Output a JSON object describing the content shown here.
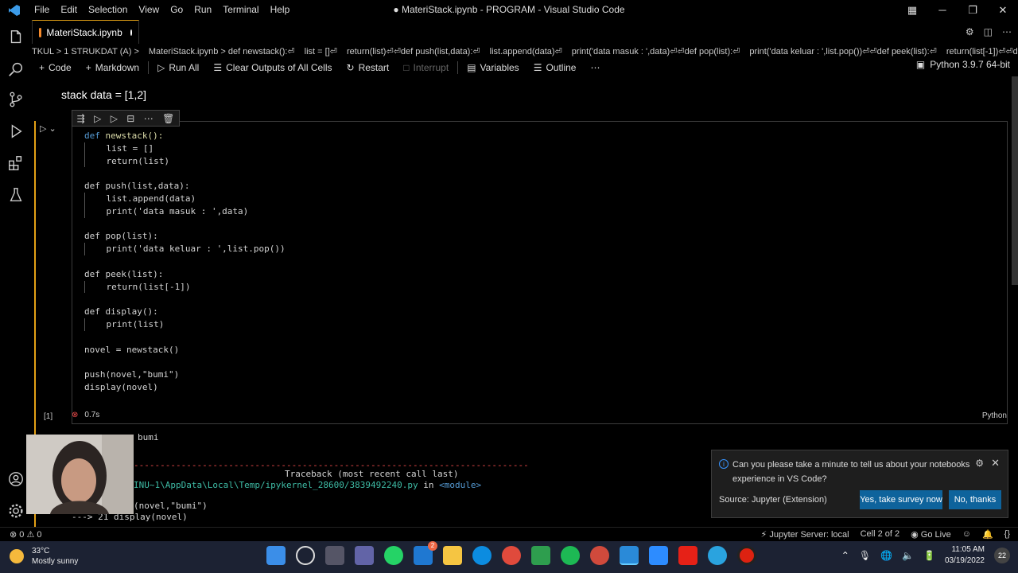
{
  "titlebar": {
    "menu": [
      "File",
      "Edit",
      "Selection",
      "View",
      "Go",
      "Run",
      "Terminal",
      "Help"
    ],
    "title": "● MateriStack.ipynb - PROGRAM - Visual Studio Code"
  },
  "tab": {
    "label": "MateriStack.ipynb"
  },
  "breadcrumbs": [
    "TKUL > 1 STRUKDAT (A) >",
    "MateriStack.ipynb > def newstack():⏎",
    "list = []⏎",
    "return(list)⏎⏎def push(list,data):⏎",
    "list.append(data)⏎",
    "print('data masuk : ',data)⏎⏎def pop(list):⏎",
    "print('data keluar : ',list.pop())⏎⏎def peek(list):⏎",
    "return(list[-1])⏎⏎d..."
  ],
  "toolbar": {
    "code": "Code",
    "markdown": "Markdown",
    "run_all": "Run All",
    "clear_outputs": "Clear Outputs of All Cells",
    "restart": "Restart",
    "interrupt": "Interrupt",
    "variables": "Variables",
    "outline": "Outline",
    "kernel": "Python 3.9.7 64-bit"
  },
  "markdown_cell": {
    "text": "stack data = [1,2]"
  },
  "cell": {
    "exec_count": "[1]",
    "duration": "0.7s",
    "language": "Python"
  },
  "code_lines": [
    "def newstack():",
    "    list = []",
    "    return(list)",
    "",
    "def push(list,data):",
    "    list.append(data)",
    "    print('data masuk : ',data)",
    "",
    "def pop(list):",
    "    print('data keluar : ',list.pop())",
    "",
    "def peek(list):",
    "    return(list[-1])",
    "",
    "def display():",
    "    print(list)",
    "",
    "novel = newstack()",
    "",
    "push(novel,\"bumi\")",
    "display(novel)"
  ],
  "output": {
    "line1": "bumi",
    "dashes": "---------------------------------------------------------------------------",
    "traceback": "Traceback (most recent call last)",
    "path": "INU~1\\AppData\\Local\\Temp/ipykernel_28600/3839492240.py",
    "in_word": " in ",
    "module": "<module>",
    "line4": "(novel,\"bumi\")",
    "line5": "---> 21 display(novel)"
  },
  "notification": {
    "message": "Can you please take a minute to tell us about your notebooks experience in VS Code?",
    "source": "Source: Jupyter (Extension)",
    "survey_button": "Yes, take survey now",
    "no_button": "No, thanks"
  },
  "statusbar": {
    "errors": "⊗ 0 ⚠ 0",
    "jupyter_server": "Jupyter Server: local",
    "cell_pos": "Cell 2 of 2",
    "go_live": "Go Live"
  },
  "taskbar": {
    "temperature": "33°C",
    "weather": "Mostly sunny",
    "time": "11:05 AM",
    "date": "03/19/2022",
    "notif_count": "22",
    "mail_badge": "2"
  },
  "colors": {
    "accent": "#e3a016",
    "keyword": "#569cd6",
    "string": "#ce9178",
    "button": "#0e639c"
  }
}
